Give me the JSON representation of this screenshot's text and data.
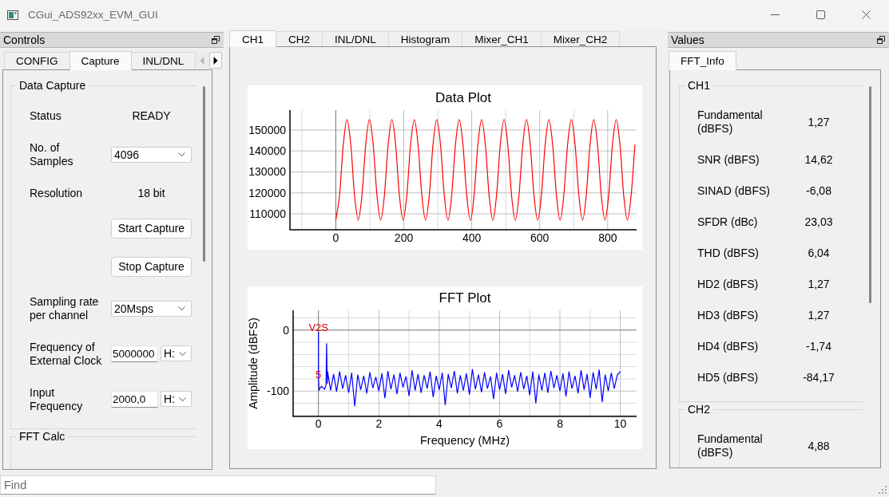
{
  "window": {
    "title": "CGui_ADS92xx_EVM_GUI"
  },
  "controls_dock": {
    "title": "Controls",
    "tabs": [
      {
        "label": "CONFIG",
        "selected": false
      },
      {
        "label": "Capture",
        "selected": true
      },
      {
        "label": "INL/DNL",
        "selected": false
      }
    ],
    "tab_scroll": [
      {
        "kind": "back",
        "disabled": true
      },
      {
        "kind": "forward",
        "disabled": false
      }
    ],
    "groups": [
      {
        "title": "Data Capture",
        "rows": [
          {
            "kind": "value",
            "label": "Status",
            "value": "READY"
          },
          {
            "kind": "combo",
            "label": "No. of\nSamples",
            "value": "4096"
          },
          {
            "kind": "value",
            "label": "Resolution",
            "value": "18 bit"
          },
          {
            "kind": "button",
            "label": "Start Capture"
          },
          {
            "kind": "button",
            "label": "Stop Capture"
          },
          {
            "kind": "combo",
            "label": "Sampling rate\nper channel",
            "value": "20Msps"
          },
          {
            "kind": "input_unit",
            "label": "Frequency of\nExternal Clock",
            "value": "5000000",
            "unit": "H:"
          },
          {
            "kind": "input_unit",
            "label": "Input\nFrequency",
            "value": "2000,0",
            "unit": "H:"
          }
        ]
      },
      {
        "title": "FFT Calc"
      }
    ]
  },
  "plot_tabs": [
    {
      "label": "CH1",
      "selected": true
    },
    {
      "label": "CH2",
      "selected": false
    },
    {
      "label": "INL/DNL",
      "selected": false
    },
    {
      "label": "Histogram",
      "selected": false
    },
    {
      "label": "Mixer_CH1",
      "selected": false
    },
    {
      "label": "Mixer_CH2",
      "selected": false
    }
  ],
  "data_plot": {
    "chart_data": {
      "type": "line",
      "title": "Data Plot",
      "x": [
        0,
        11,
        22,
        33,
        44,
        55,
        66,
        77,
        88,
        99,
        110,
        121,
        132,
        143,
        154,
        165,
        176,
        187,
        198,
        209,
        220,
        231,
        242,
        253,
        264,
        275,
        286,
        297,
        308,
        319,
        330,
        341,
        352,
        363,
        374,
        385,
        396,
        407,
        418,
        429,
        440,
        451,
        462,
        473,
        484,
        495,
        506,
        517,
        528,
        539,
        550,
        561,
        572,
        583,
        594,
        605,
        616,
        627,
        638,
        649,
        660,
        671,
        682,
        693,
        704,
        715,
        726,
        737,
        748,
        759,
        770,
        781,
        792,
        803,
        814,
        825,
        836,
        847,
        858,
        869,
        880
      ],
      "series": [
        {
          "color": "#ff0000",
          "values": [
            107000,
            119000,
            143000,
            155000,
            143000,
            119000,
            107000,
            119000,
            143000,
            155000,
            143000,
            119000,
            107000,
            119000,
            143000,
            155000,
            143000,
            119000,
            107000,
            119000,
            143000,
            155000,
            143000,
            119000,
            107000,
            119000,
            143000,
            155000,
            143000,
            119000,
            107000,
            119000,
            143000,
            155000,
            143000,
            119000,
            107000,
            119000,
            143000,
            155000,
            143000,
            119000,
            107000,
            119000,
            143000,
            155000,
            143000,
            119000,
            107000,
            119000,
            143000,
            155000,
            143000,
            119000,
            107000,
            119000,
            143000,
            155000,
            143000,
            119000,
            107000,
            119000,
            143000,
            155000,
            143000,
            119000,
            107000,
            119000,
            143000,
            155000,
            143000,
            119000,
            107000,
            119000,
            143000,
            155000,
            143000,
            119000,
            107000,
            119000,
            143000
          ]
        }
      ],
      "xlim": [
        -135,
        885
      ],
      "ylim": [
        102400,
        159500
      ],
      "xticks": [
        0,
        200,
        400,
        600,
        800
      ],
      "yticks": [
        110000,
        120000,
        130000,
        140000,
        150000
      ],
      "grid": true
    }
  },
  "fft_plot": {
    "chart_data": {
      "type": "line",
      "title": "FFT Plot",
      "xlabel": "Frequency (MHz)",
      "ylabel": "Amplitude (dBFS)",
      "x": [
        0,
        0,
        0.02,
        0.1,
        0.2,
        0.25,
        0.27,
        0.29,
        0.3,
        0.4,
        0.5,
        0.6,
        0.7,
        0.8,
        0.9,
        1,
        1.1,
        1.2,
        1.3,
        1.4,
        1.5,
        1.6,
        1.7,
        1.8,
        1.9,
        2,
        2.1,
        2.2,
        2.3,
        2.4,
        2.5,
        2.6,
        2.7,
        2.8,
        2.9,
        3,
        3.1,
        3.2,
        3.3,
        3.4,
        3.5,
        3.6,
        3.7,
        3.8,
        3.9,
        4,
        4.1,
        4.2,
        4.3,
        4.4,
        4.5,
        4.6,
        4.7,
        4.8,
        4.9,
        5,
        5.1,
        5.2,
        5.3,
        5.4,
        5.5,
        5.6,
        5.7,
        5.8,
        5.9,
        6,
        6.1,
        6.2,
        6.3,
        6.4,
        6.5,
        6.6,
        6.7,
        6.8,
        6.9,
        7,
        7.1,
        7.2,
        7.3,
        7.4,
        7.5,
        7.6,
        7.7,
        7.8,
        7.9,
        8,
        8.1,
        8.2,
        8.3,
        8.4,
        8.5,
        8.6,
        8.7,
        8.8,
        8.9,
        9,
        9.1,
        9.2,
        9.3,
        9.4,
        9.5,
        9.6,
        9.7,
        9.8,
        9.9,
        10
      ],
      "series": [
        {
          "color": "#0000ff",
          "values": [
            -3,
            -80,
            -98,
            -92,
            -97,
            -90,
            -22,
            -88,
            -68,
            -99,
            -72,
            -101,
            -68,
            -96,
            -74,
            -103,
            -70,
            -125,
            -73,
            -98,
            -75,
            -104,
            -69,
            -95,
            -77,
            -100,
            -71,
            -112,
            -67,
            -97,
            -73,
            -105,
            -70,
            -94,
            -76,
            -108,
            -66,
            -99,
            -72,
            -103,
            -74,
            -96,
            -68,
            -110,
            -75,
            -98,
            -70,
            -123,
            -72,
            -95,
            -67,
            -104,
            -74,
            -99,
            -71,
            -106,
            -64,
            -97,
            -73,
            -102,
            -69,
            -96,
            -76,
            -113,
            -70,
            -98,
            -72,
            -105,
            -66,
            -94,
            -74,
            -101,
            -69,
            -97,
            -75,
            -107,
            -68,
            -120,
            -73,
            -99,
            -70,
            -103,
            -67,
            -95,
            -74,
            -100,
            -71,
            -109,
            -68,
            -96,
            -75,
            -104,
            -66,
            -98,
            -72,
            -111,
            -69,
            -97,
            -65,
            -118,
            -73,
            -100,
            -70,
            -96,
            -74,
            -68
          ]
        }
      ],
      "xlim": [
        -0.84,
        10.54
      ],
      "ylim": [
        -141.7,
        32.5
      ],
      "xticks": [
        0,
        2,
        4,
        6,
        8,
        10
      ],
      "yticks": [
        0,
        -100
      ],
      "grid": true,
      "annotations": [
        {
          "text": "V2S",
          "x": 0,
          "y": -3
        },
        {
          "text": "5",
          "x": 0,
          "y": -80
        }
      ]
    }
  },
  "values_dock": {
    "title": "Values",
    "tabs": [
      {
        "label": "FFT_Info",
        "selected": true
      }
    ],
    "groups": [
      {
        "title": "CH1",
        "rows": [
          {
            "label": "Fundamental (dBFS)",
            "value": "1,27"
          },
          {
            "label": "SNR (dBFS)",
            "value": "14,62"
          },
          {
            "label": "SINAD (dBFS)",
            "value": "-6,08"
          },
          {
            "label": "SFDR (dBc)",
            "value": "23,03"
          },
          {
            "label": "THD (dBFS)",
            "value": "6,04"
          },
          {
            "label": "HD2 (dBFS)",
            "value": "1,27"
          },
          {
            "label": "HD3 (dBFS)",
            "value": "1,27"
          },
          {
            "label": "HD4 (dBFS)",
            "value": "-1,74"
          },
          {
            "label": "HD5 (dBFS)",
            "value": "-84,17"
          }
        ]
      },
      {
        "title": "CH2",
        "rows": [
          {
            "label": "Fundamental (dBFS)",
            "value": "4,88"
          }
        ]
      }
    ]
  },
  "find_bar": {
    "placeholder": "Find"
  }
}
